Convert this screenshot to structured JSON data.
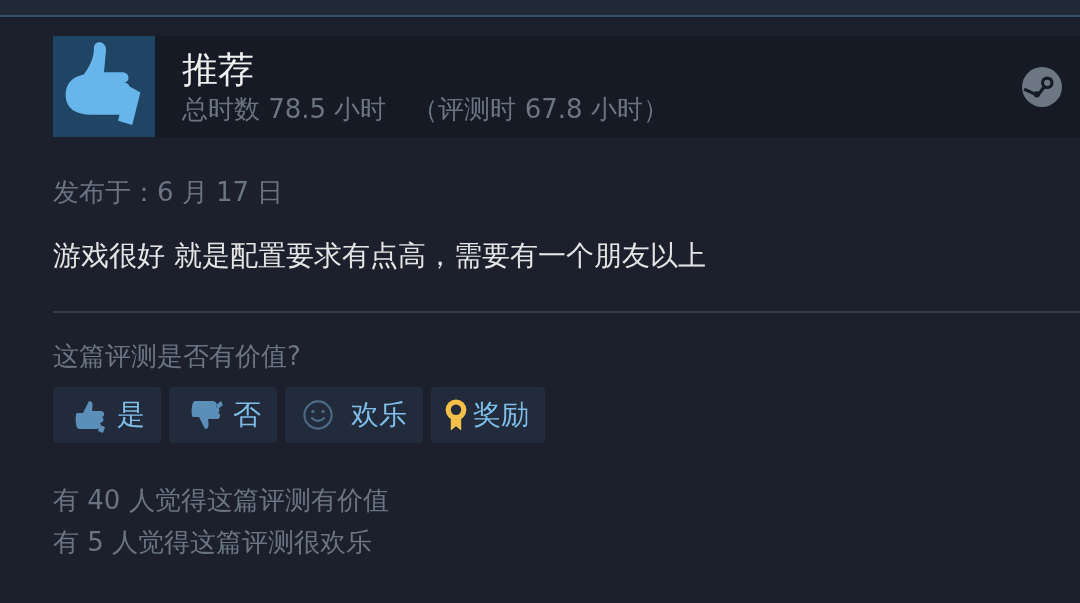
{
  "review": {
    "verdict": "推荐",
    "hours": "总时数 78.5 小时",
    "hours_at_review": "（评测时 67.8 小时）",
    "posted": "发布于：6 月 17 日",
    "text": "游戏很好 就是配置要求有点高，需要有一个朋友以上"
  },
  "helpful": {
    "question": "这篇评测是否有价值?",
    "buttons": [
      {
        "kind": "up",
        "label": "是"
      },
      {
        "kind": "down",
        "label": "否"
      },
      {
        "kind": "smile",
        "label": "欢乐"
      },
      {
        "kind": "award",
        "label": "奖励"
      }
    ]
  },
  "stats": [
    "有 40 人觉得这篇评测有价值",
    "有 5 人觉得这篇评测很欢乐"
  ]
}
